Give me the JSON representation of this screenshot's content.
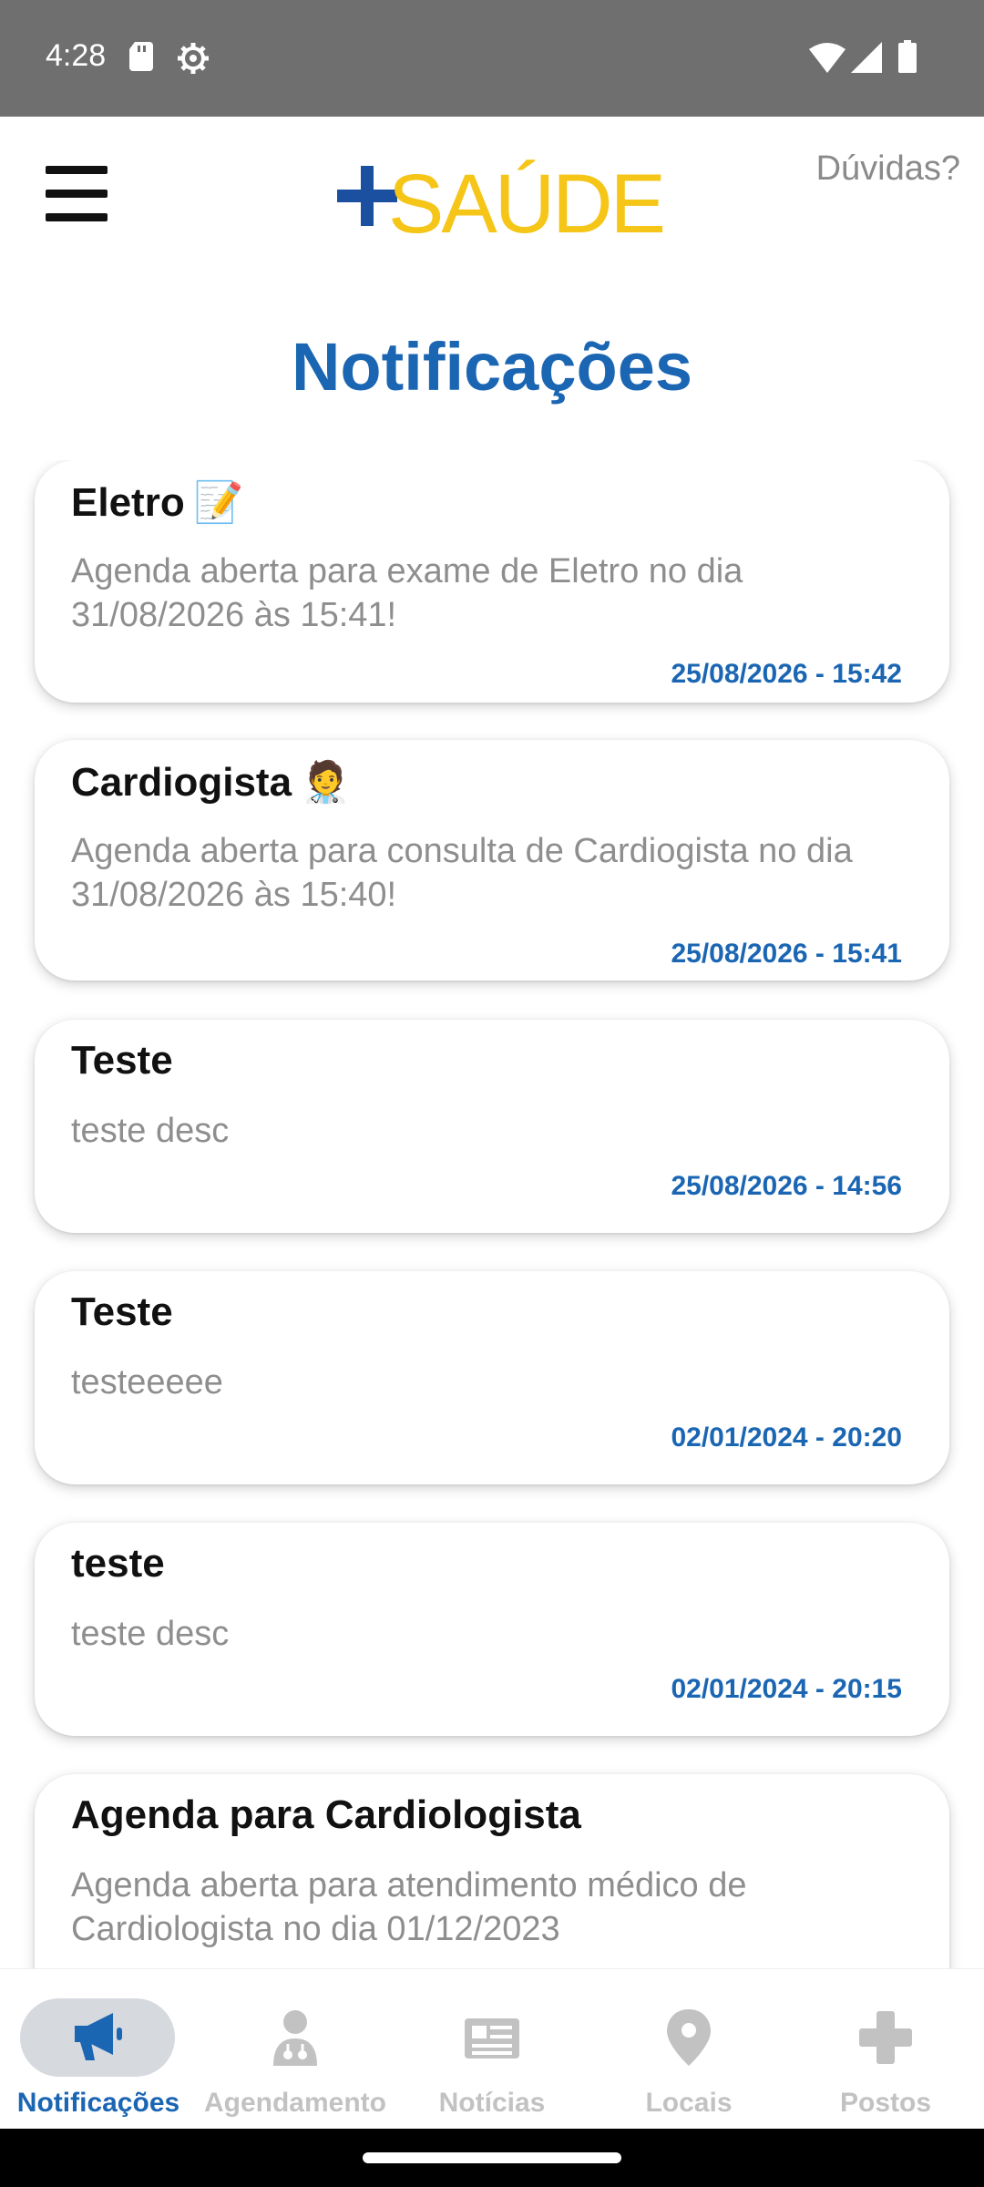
{
  "status_bar": {
    "time": "4:28",
    "icons": [
      "sd-card-icon",
      "settings-gear-icon",
      "wifi-icon",
      "cell-signal-icon",
      "battery-icon"
    ]
  },
  "header": {
    "menu_icon": "hamburger-menu-icon",
    "logo_text": "SAÚDE",
    "help_label": "Dúvidas?"
  },
  "page": {
    "title": "Notificações"
  },
  "notifications": [
    {
      "title": "Eletro",
      "emoji": "📝",
      "description": "Agenda aberta para exame de Eletro no dia 31/08/2026 às 15:41!",
      "date": "25/08/2026 - 15:42"
    },
    {
      "title": "Cardiogista",
      "emoji": "🧑‍⚕️",
      "description": "Agenda aberta para consulta de Cardiogista no dia 31/08/2026 às 15:40!",
      "date": "25/08/2026 - 15:41"
    },
    {
      "title": "Teste",
      "emoji": "",
      "description": "teste desc",
      "date": "25/08/2026 - 14:56"
    },
    {
      "title": "Teste",
      "emoji": "",
      "description": "testeeeee",
      "date": "02/01/2024 - 20:20"
    },
    {
      "title": "teste",
      "emoji": "",
      "description": "teste desc",
      "date": "02/01/2024 - 20:15"
    },
    {
      "title": "Agenda para Cardiologista",
      "emoji": "",
      "description": "Agenda aberta para atendimento médico de Cardiologista no dia 01/12/2023",
      "date": ""
    }
  ],
  "bottom_nav": {
    "active": "Notificações",
    "items": [
      {
        "label": "Notificações",
        "icon": "megaphone-icon"
      },
      {
        "label": "Agendamento",
        "icon": "doctor-icon"
      },
      {
        "label": "Notícias",
        "icon": "newspaper-icon"
      },
      {
        "label": "Locais",
        "icon": "map-pin-icon"
      },
      {
        "label": "Postos",
        "icon": "medical-cross-icon"
      }
    ]
  },
  "colors": {
    "brand_blue": "#1b66b3",
    "brand_yellow": "#f5c518",
    "status_bar": "#6f6f6f",
    "muted_text": "#8e8e8e"
  }
}
